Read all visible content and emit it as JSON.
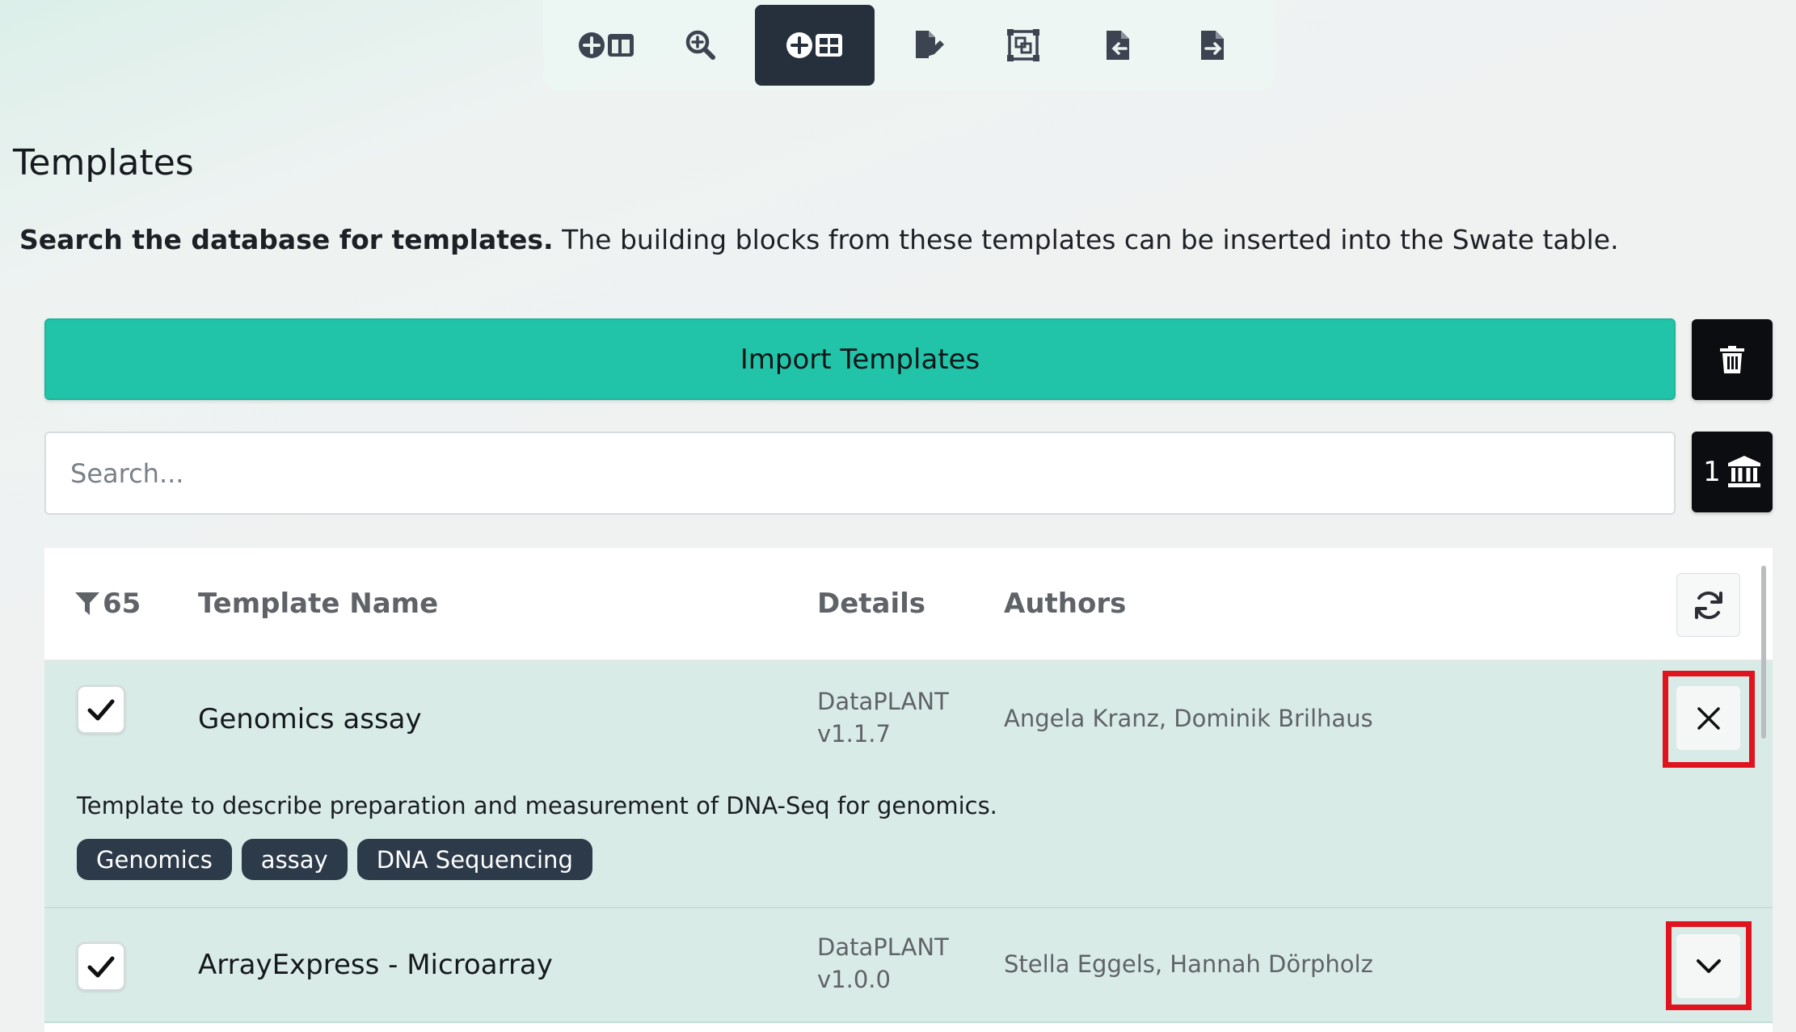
{
  "toolbar": {
    "items": [
      {
        "icon": "add-building-block-icon",
        "active": false
      },
      {
        "icon": "search-term-icon",
        "active": false
      },
      {
        "icon": "add-template-icon",
        "active": true
      },
      {
        "icon": "file-edit-icon",
        "active": false
      },
      {
        "icon": "protocol-icon",
        "active": false
      },
      {
        "icon": "file-import-icon",
        "active": false
      },
      {
        "icon": "file-export-icon",
        "active": false
      }
    ]
  },
  "page": {
    "title": "Templates",
    "intro_bold": "Search the database for templates.",
    "intro_rest": " The building blocks from these templates can be inserted into the Swate table."
  },
  "actions": {
    "import_label": "Import Templates",
    "trash_icon": "trash-icon",
    "db_count": "1",
    "db_icon": "database-icon"
  },
  "search": {
    "placeholder": "Search...",
    "value": ""
  },
  "table": {
    "filter_count": "65",
    "headers": {
      "name": "Template Name",
      "details": "Details",
      "authors": "Authors"
    },
    "rows": [
      {
        "checked": true,
        "name": "Genomics assay",
        "org": "DataPLANT",
        "version": "v1.1.7",
        "authors": "Angela Kranz, Dominik Brilhaus",
        "expanded": true,
        "description": "Template to describe preparation and measurement of DNA-Seq for genomics.",
        "tags": [
          "Genomics",
          "assay",
          "DNA Sequencing"
        ],
        "action_icon": "close-icon"
      },
      {
        "checked": true,
        "name": "ArrayExpress - Microarray",
        "org": "DataPLANT",
        "version": "v1.0.0",
        "authors": "Stella Eggels, Hannah Dörpholz",
        "expanded": false,
        "action_icon": "chevron-down-icon"
      }
    ]
  },
  "colors": {
    "accent": "#21c4a8",
    "dark": "#26303d",
    "row_bg": "#d9ebe7",
    "highlight": "#e0141e"
  }
}
